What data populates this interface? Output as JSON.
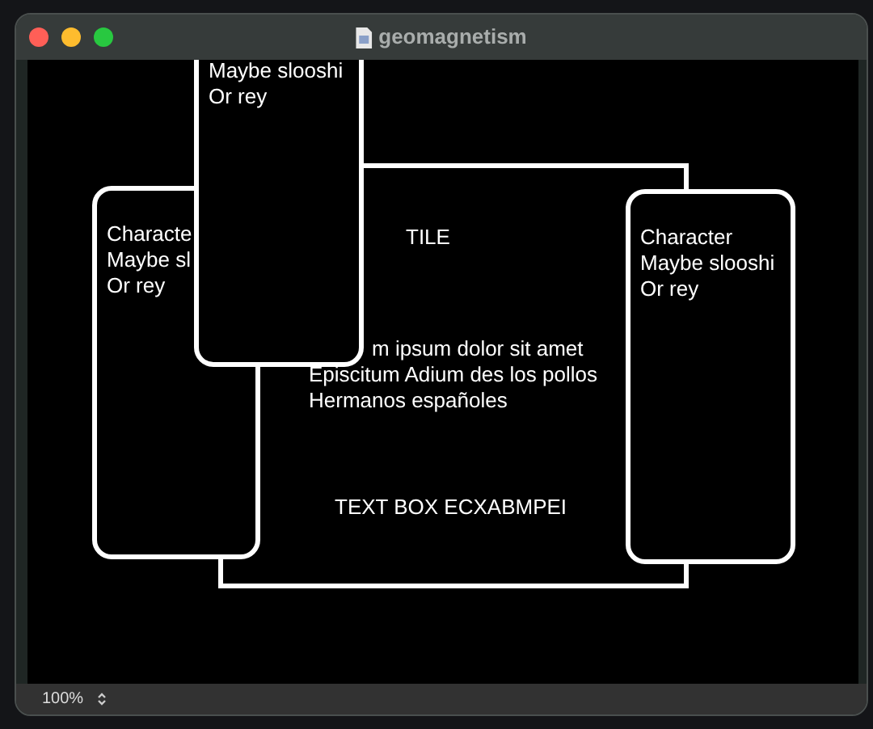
{
  "window": {
    "title": "geomagnetism"
  },
  "cards": [
    {
      "lines": [
        "Characte",
        "Maybe sl",
        "Or rey"
      ]
    },
    {
      "lines": [
        "Maybe slooshi",
        "Or rey"
      ]
    },
    {
      "lines": [
        "Character",
        "Maybe slooshi",
        "Or rey"
      ]
    }
  ],
  "texts": [
    {
      "kind": "heading",
      "lines": [
        "TILE"
      ]
    },
    {
      "kind": "paragraph",
      "lines": [
        "m ipsum dolor sit amet",
        "Episcitum Adium des los pollos",
        "Hermanos españoles"
      ]
    },
    {
      "kind": "heading",
      "lines": [
        "TEXT BOX ECXABMPEI"
      ]
    }
  ],
  "status_bar": {
    "zoom": "100%"
  }
}
